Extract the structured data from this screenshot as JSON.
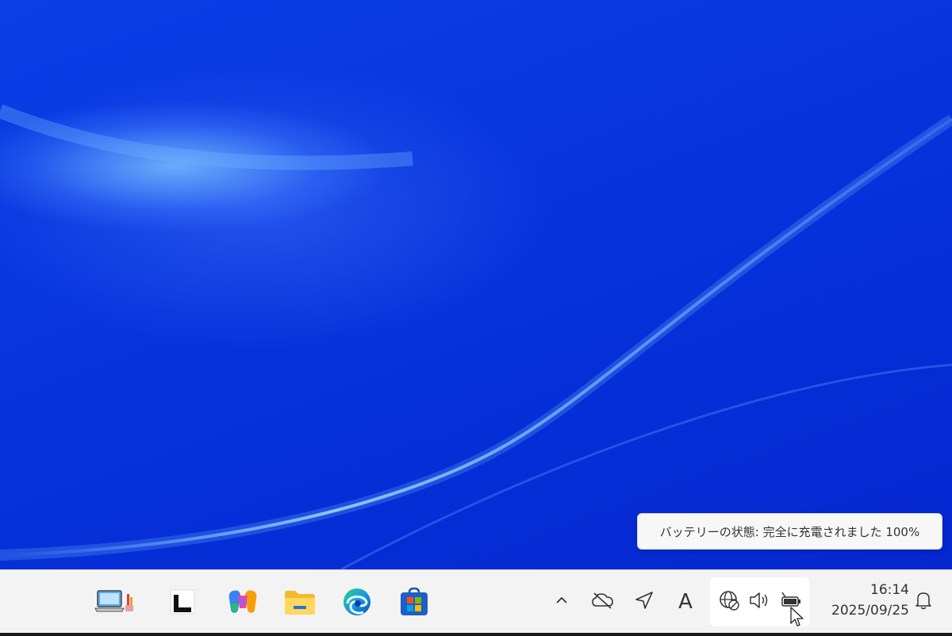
{
  "tooltip": {
    "text": "バッテリーの状態: 完全に充電されました 100%"
  },
  "taskbar": {
    "apps": [
      {
        "name": "laptop-app",
        "icon": "laptop-paint-icon"
      },
      {
        "name": "terminal-app",
        "icon": "black-square-icon"
      },
      {
        "name": "copilot-app",
        "icon": "copilot-icon"
      },
      {
        "name": "file-explorer-app",
        "icon": "folder-icon"
      },
      {
        "name": "edge-app",
        "icon": "edge-icon"
      },
      {
        "name": "store-app",
        "icon": "store-icon"
      }
    ],
    "tray": {
      "overflow": "chevron-up-icon",
      "onedrive": "cloud-offline-icon",
      "location": "location-arrow-icon",
      "ime_label": "A",
      "network": "globe-no-internet-icon",
      "volume": "speaker-icon",
      "battery": "battery-charging-icon"
    },
    "clock": {
      "time": "16:14",
      "date": "2025/09/25"
    },
    "notification": "bell-icon"
  }
}
